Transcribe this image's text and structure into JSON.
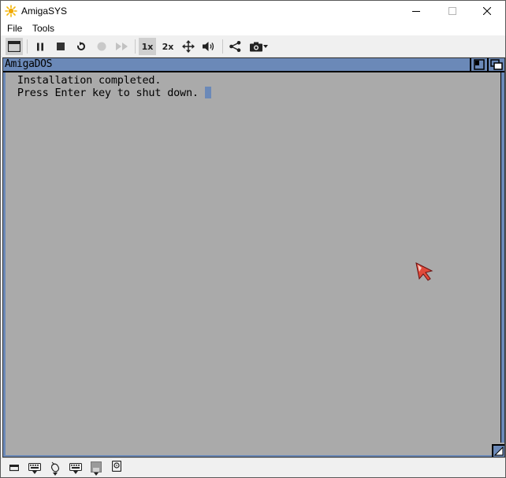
{
  "window": {
    "title": "AmigaSYS",
    "icon": "amigasys-sun-icon"
  },
  "menubar": {
    "items": [
      {
        "label": "File"
      },
      {
        "label": "Tools"
      }
    ]
  },
  "toolbar": {
    "scale_1x_label": "1x",
    "scale_2x_label": "2x",
    "icons": [
      "window-mode-icon",
      "pause-icon",
      "stop-icon",
      "reset-icon",
      "record-icon",
      "fast-forward-icon",
      "move-icon",
      "volume-icon",
      "share-icon",
      "camera-icon"
    ]
  },
  "amiga": {
    "window_title": "AmigaDOS",
    "console_lines": [
      " Installation completed.",
      " Press Enter key to shut down."
    ],
    "colors": {
      "screen_bg": "#aaaaaa",
      "title_bar": "#6b89b8",
      "cursor": "#6b89b8",
      "pointer": "#e04a3a"
    }
  },
  "statusbar": {
    "icons": [
      "display-icon",
      "keyboard-icon",
      "mouse-icon",
      "keyboard-alt-icon",
      "floppy-icon",
      "harddisk-icon"
    ]
  }
}
